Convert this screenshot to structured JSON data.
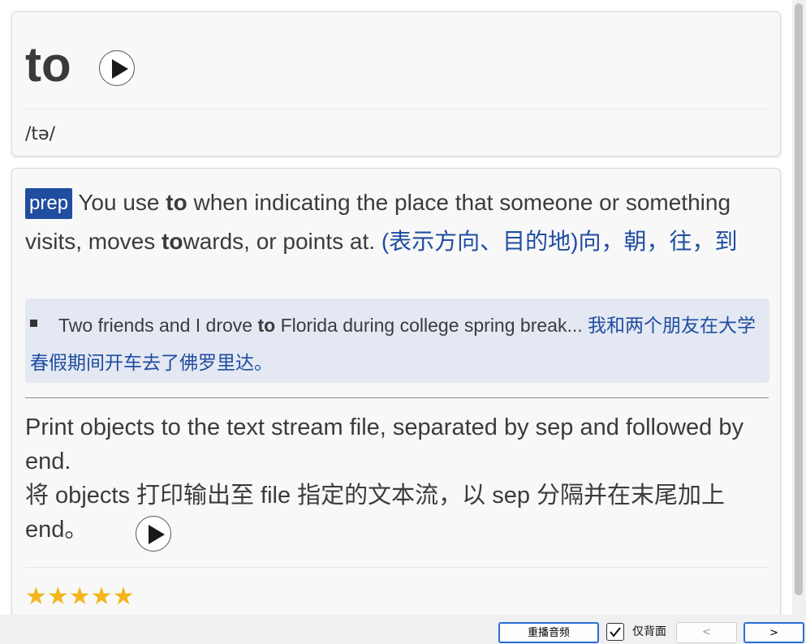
{
  "word_card": {
    "headword": "to",
    "phonetic": "/tə/"
  },
  "definition": {
    "pos": "prep",
    "text_before": " You use ",
    "bold_to": "to",
    "text_middle": " when indicating the place that someone or something visits, moves ",
    "bold_to2": "to",
    "text_end": "wards, or points at. ",
    "chinese": "(表示方向、目的地)向，朝，往，到",
    "example_before": "Two friends and I drove ",
    "example_bold": "to",
    "example_after": " Florida during college spring break... ",
    "example_chinese": "我和两个朋友在大学春假期间开车去了佛罗里达。"
  },
  "sentence": {
    "english": "Print objects to the text stream file, separated by sep and followed by end.",
    "chinese": "将 objects 打印输出至 file 指定的文本流，以 sep 分隔并在末尾加上 end。"
  },
  "rating": {
    "stars": "★★★★★",
    "value": 5,
    "max": 5
  },
  "toolbar": {
    "replay_label": "重播音频",
    "back_only_label": "仅背面",
    "back_only_checked": true,
    "prev_label": "<",
    "next_label": ">"
  },
  "colors": {
    "accent": "#1f4da0",
    "star": "#f2b61c",
    "example_bg": "#e3e8f2"
  }
}
